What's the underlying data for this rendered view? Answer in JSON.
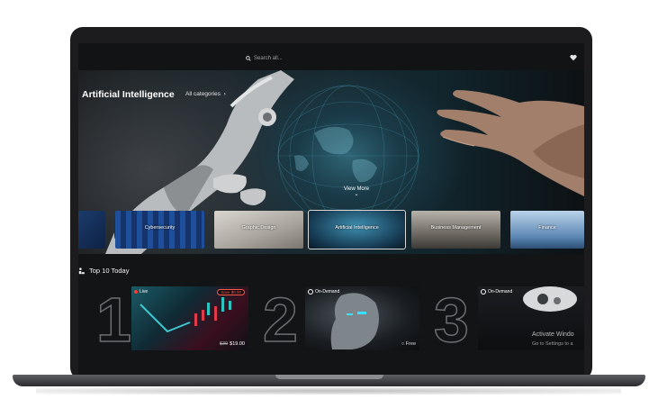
{
  "header": {
    "search_placeholder": "Search all..."
  },
  "hero": {
    "title": "Artificial Intelligence",
    "all_categories": "All categories",
    "view_more": "View More"
  },
  "categories": [
    {
      "label": ""
    },
    {
      "label": "Cybersecurity"
    },
    {
      "label": "Graphic Design"
    },
    {
      "label": "Artificial Intelligence"
    },
    {
      "label": "Business Management"
    },
    {
      "label": "Finance"
    }
  ],
  "top10": {
    "title": "Top 10 Today",
    "items": [
      {
        "rank": "1",
        "badge": "Live",
        "pill": "Save $0.00",
        "old_price": "$39",
        "price": "$19.00"
      },
      {
        "rank": "2",
        "badge": "On-Demand",
        "price_label": "Free"
      },
      {
        "rank": "3",
        "badge": "On-Demand"
      }
    ]
  },
  "watermark": {
    "line1": "Activate Windo",
    "line2": "Go to Settings to a"
  },
  "colors": {
    "screen_bg": "#131415",
    "active_outline": "#d8d8d8",
    "live_accent": "#ff5a4a"
  }
}
